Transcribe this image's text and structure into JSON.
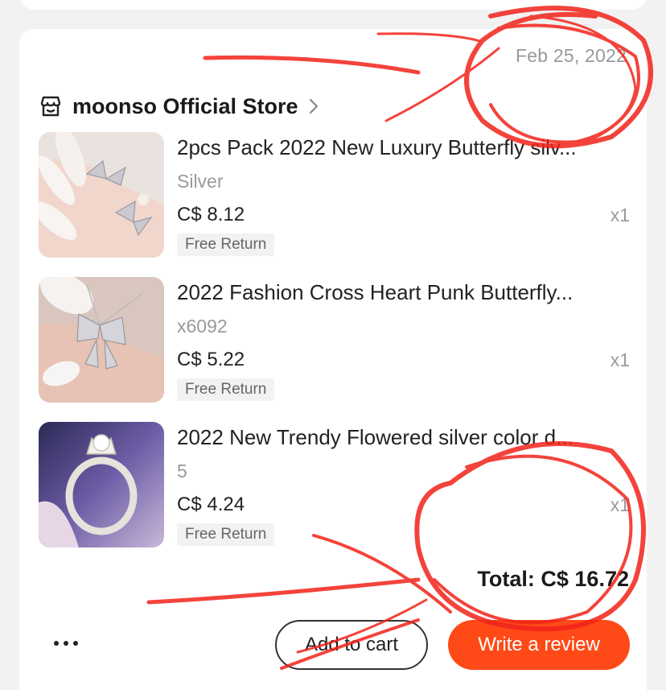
{
  "order": {
    "date": "Feb 25, 2022",
    "store_name": "moonso Official Store",
    "items": [
      {
        "title": "2pcs Pack 2022 New Luxury Butterfly silv...",
        "variant": "Silver",
        "price": "C$ 8.12",
        "qty": "x1",
        "tag": "Free Return"
      },
      {
        "title": "2022 Fashion Cross Heart Punk Butterfly...",
        "variant": "x6092",
        "price": "C$ 5.22",
        "qty": "x1",
        "tag": "Free Return"
      },
      {
        "title": "2022 New Trendy Flowered silver color d...",
        "variant": "5",
        "price": "C$ 4.24",
        "qty": "x1",
        "tag": "Free Return"
      }
    ],
    "total": "Total: C$ 16.72"
  },
  "actions": {
    "add_to_cart": "Add to cart",
    "write_review": "Write a review"
  },
  "colors": {
    "accent": "#ff4a17",
    "annotation": "#f2231a"
  },
  "icons": [
    "store-icon",
    "chevron-right-icon",
    "more-icon"
  ]
}
